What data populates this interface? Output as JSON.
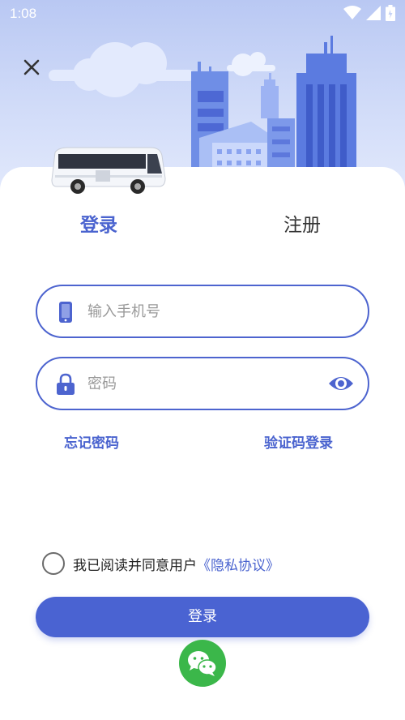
{
  "status_bar": {
    "time": "1:08"
  },
  "tabs": [
    {
      "label": "登录",
      "active": true
    },
    {
      "label": "注册",
      "active": false
    }
  ],
  "form": {
    "phone_placeholder": "输入手机号",
    "password_placeholder": "密码"
  },
  "links": {
    "forgot_password": "忘记密码",
    "sms_login": "验证码登录"
  },
  "agreement": {
    "text": "我已阅读并同意用户",
    "link": "《隐私协议》",
    "checked": false
  },
  "login_button": "登录",
  "colors": {
    "accent": "#4a63d2",
    "wechat": "#3bb74a",
    "sky": "#c4d1f6"
  },
  "icons": [
    "close-icon",
    "phone-icon",
    "lock-icon",
    "eye-icon",
    "wechat-icon",
    "wifi-icon",
    "signal-icon",
    "battery-icon"
  ]
}
